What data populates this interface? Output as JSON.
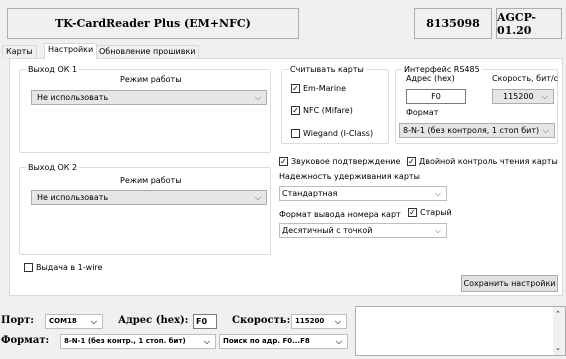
{
  "header": {
    "title": "TK-CardReader Plus (EM+NFC)",
    "serial": "8135098",
    "firmware": "AGCP-01.20"
  },
  "tabs": [
    {
      "label": "Карты"
    },
    {
      "label": "Настройки"
    },
    {
      "label": "Обновление прошивки"
    }
  ],
  "output1": {
    "legend": "Выход ОК 1",
    "mode_label": "Режим работы",
    "mode_value": "Не использовать"
  },
  "output2": {
    "legend": "Выход ОК 2",
    "mode_label": "Режим работы",
    "mode_value": "Не использовать"
  },
  "onewire": {
    "label": "Выдача в 1-wire",
    "checked": false
  },
  "read_cards": {
    "legend": "Считывать карты",
    "items": [
      {
        "label": "Em-Marine",
        "checked": true
      },
      {
        "label": "NFC (Mifare)",
        "checked": true
      },
      {
        "label": "Wiegand (I-Class)",
        "checked": false
      }
    ]
  },
  "rs485": {
    "legend": "Интерфейс RS485",
    "address_label": "Адрес (hex)",
    "address_value": "F0",
    "speed_label": "Скорость, бит/с",
    "speed_value": "115200",
    "format_label": "Формат",
    "format_value": "8-N-1 (без контроля, 1 стоп бит)"
  },
  "sound": {
    "label": "Звуковое подтверждение",
    "checked": true
  },
  "double_check": {
    "label": "Двойной контроль чтения карты",
    "checked": true
  },
  "reliability": {
    "label": "Надежность удерживания карты",
    "value": "Стандартная"
  },
  "card_format": {
    "label": "Формат вывода номера карт",
    "value": "Десятичный с точкой"
  },
  "old": {
    "label": "Старый",
    "checked": true
  },
  "save_button": "Сохранить настройки",
  "bottom": {
    "port_label": "Порт:",
    "port_value": "COM18",
    "address_label": "Адрес (hex):",
    "address_value": "F0",
    "speed_label": "Скорость:",
    "speed_value": "115200",
    "format_label": "Формат:",
    "format_value": "8-N-1 (без контр., 1 стоп. бит)",
    "search_value": "Поиск по адр. F0...F8"
  },
  "icons": {
    "dropdown": "chevron-down-icon",
    "check": "check-icon",
    "scroll_up": "scroll-up-icon",
    "scroll_down": "scroll-down-icon"
  }
}
